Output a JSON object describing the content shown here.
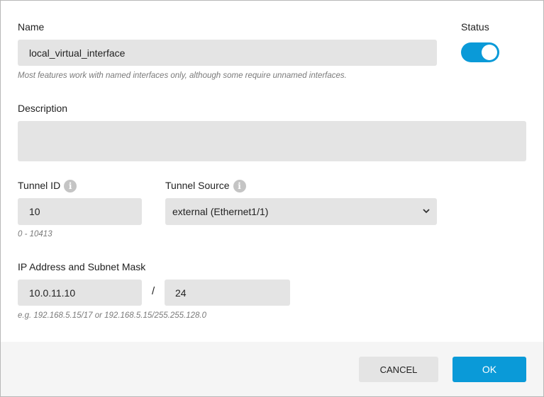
{
  "name": {
    "label": "Name",
    "value": "local_virtual_interface",
    "hint": "Most features work with named interfaces only, although some require unnamed interfaces."
  },
  "status": {
    "label": "Status",
    "enabled": true,
    "color": "#0a9ad8"
  },
  "description": {
    "label": "Description",
    "value": ""
  },
  "tunnel_id": {
    "label": "Tunnel ID",
    "value": "10",
    "hint": "0 - 10413"
  },
  "tunnel_source": {
    "label": "Tunnel Source",
    "value": "external (Ethernet1/1)"
  },
  "ip": {
    "label": "IP Address and Subnet Mask",
    "address": "10.0.11.10",
    "separator": "/",
    "mask": "24",
    "hint": "e.g. 192.168.5.15/17 or 192.168.5.15/255.255.128.0"
  },
  "footer": {
    "cancel": "CANCEL",
    "ok": "OK"
  }
}
